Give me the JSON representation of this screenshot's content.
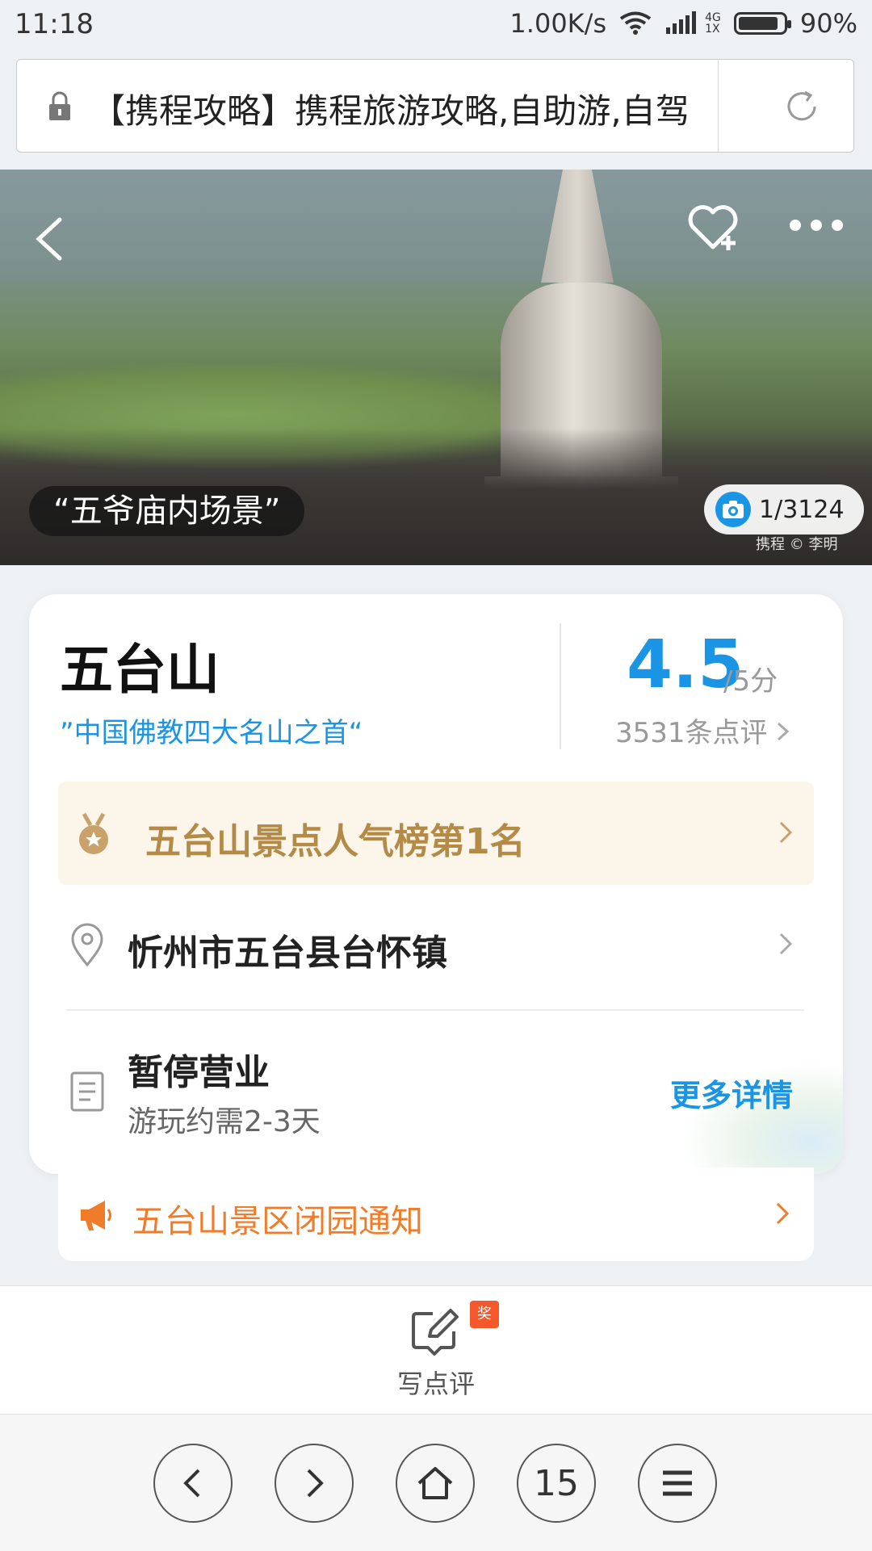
{
  "status_bar": {
    "time": "11:18",
    "speed": "1.00K/s",
    "network_top": "4G",
    "network_bottom": "1X",
    "battery": "90%",
    "battery_level": 0.9
  },
  "url_bar": {
    "url_text": "【携程攻略】携程旅游攻略,自助游,自驾"
  },
  "hero": {
    "caption": "“五爷庙内场景”",
    "photo_counter": "1/3124",
    "credit": "携程 © 李明"
  },
  "poi": {
    "name": "五台山",
    "slogan": "”中国佛教四大名山之首“",
    "score": "4.5",
    "score_unit": "/5分",
    "reviews": "3531条点评",
    "rank": "五台山景点人气榜第1名",
    "location": "忻州市五台县台怀镇",
    "status": "暂停营业",
    "duration": "游玩约需2-3天",
    "more_details": "更多详情"
  },
  "notice": {
    "text": "五台山景区闭园通知"
  },
  "review_bar": {
    "label": "写点评",
    "badge": "奖"
  },
  "browser_nav": {
    "tab_count": "15"
  },
  "colors": {
    "accent_blue": "#1a94e4",
    "rank_gold": "#b48a47",
    "notice_orange": "#f07b28"
  }
}
